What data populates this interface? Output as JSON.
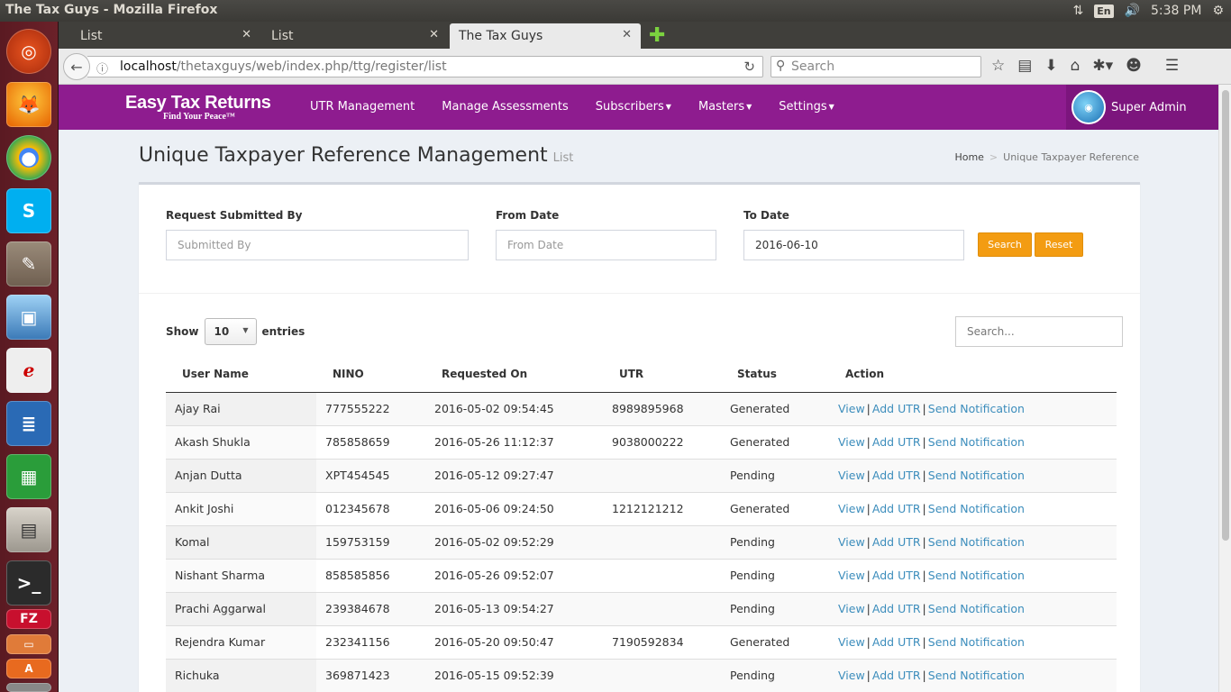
{
  "os": {
    "window_title": "The Tax Guys - Mozilla Firefox",
    "keyboard_layout": "En",
    "clock": "5:38 PM"
  },
  "browser": {
    "tabs": [
      {
        "label": "List"
      },
      {
        "label": "List"
      },
      {
        "label": "The Tax Guys",
        "active": true
      }
    ],
    "url_host": "localhost",
    "url_path": "/thetaxguys/web/index.php/ttg/register/list",
    "search_placeholder": "Search"
  },
  "app": {
    "logo_text": "Easy Tax Returns",
    "logo_tagline": "Find Your Peace™",
    "menu": [
      {
        "label": "UTR Management",
        "dropdown": false
      },
      {
        "label": "Manage Assessments",
        "dropdown": false
      },
      {
        "label": "Subscribers",
        "dropdown": true
      },
      {
        "label": "Masters",
        "dropdown": true
      },
      {
        "label": "Settings",
        "dropdown": true
      }
    ],
    "user_name": "Super Admin",
    "brand_color": "#8e1c8f",
    "accent_color": "#f39c12",
    "link_color": "#3c8dbc"
  },
  "page": {
    "title": "Unique Taxpayer Reference Management",
    "subtitle": "List",
    "breadcrumb": {
      "home": "Home",
      "current": "Unique Taxpayer Reference"
    }
  },
  "filters": {
    "submitted_by_label": "Request Submitted By",
    "submitted_by_placeholder": "Submitted By",
    "submitted_by_value": "",
    "from_date_label": "From Date",
    "from_date_placeholder": "From Date",
    "from_date_value": "",
    "to_date_label": "To Date",
    "to_date_value": "2016-06-10",
    "search_button": "Search",
    "reset_button": "Reset"
  },
  "table_controls": {
    "show_label": "Show",
    "page_size": "10",
    "entries_label": "entries",
    "search_placeholder": "Search..."
  },
  "table": {
    "columns": [
      "User Name",
      "NINO",
      "Requested On",
      "UTR",
      "Status",
      "Action"
    ],
    "action_links": [
      "View",
      "Add UTR",
      "Send Notification"
    ],
    "rows": [
      {
        "user": "Ajay Rai",
        "nino": "777555222",
        "requested": "2016-05-02 09:54:45",
        "utr": "8989895968",
        "status": "Generated"
      },
      {
        "user": "Akash Shukla",
        "nino": "785858659",
        "requested": "2016-05-26 11:12:37",
        "utr": "9038000222",
        "status": "Generated"
      },
      {
        "user": "Anjan Dutta",
        "nino": "XPT454545",
        "requested": "2016-05-12 09:27:47",
        "utr": "",
        "status": "Pending"
      },
      {
        "user": "Ankit Joshi",
        "nino": "012345678",
        "requested": "2016-05-06 09:24:50",
        "utr": "1212121212",
        "status": "Generated"
      },
      {
        "user": "Komal",
        "nino": "159753159",
        "requested": "2016-05-02 09:52:29",
        "utr": "",
        "status": "Pending"
      },
      {
        "user": "Nishant Sharma",
        "nino": "858585856",
        "requested": "2016-05-26 09:52:07",
        "utr": "",
        "status": "Pending"
      },
      {
        "user": "Prachi Aggarwal",
        "nino": "239384678",
        "requested": "2016-05-13 09:54:27",
        "utr": "",
        "status": "Pending"
      },
      {
        "user": "Rejendra Kumar",
        "nino": "232341156",
        "requested": "2016-05-20 09:50:47",
        "utr": "7190592834",
        "status": "Generated"
      },
      {
        "user": "Richuka",
        "nino": "369871423",
        "requested": "2016-05-15 09:52:39",
        "utr": "",
        "status": "Pending"
      }
    ]
  }
}
